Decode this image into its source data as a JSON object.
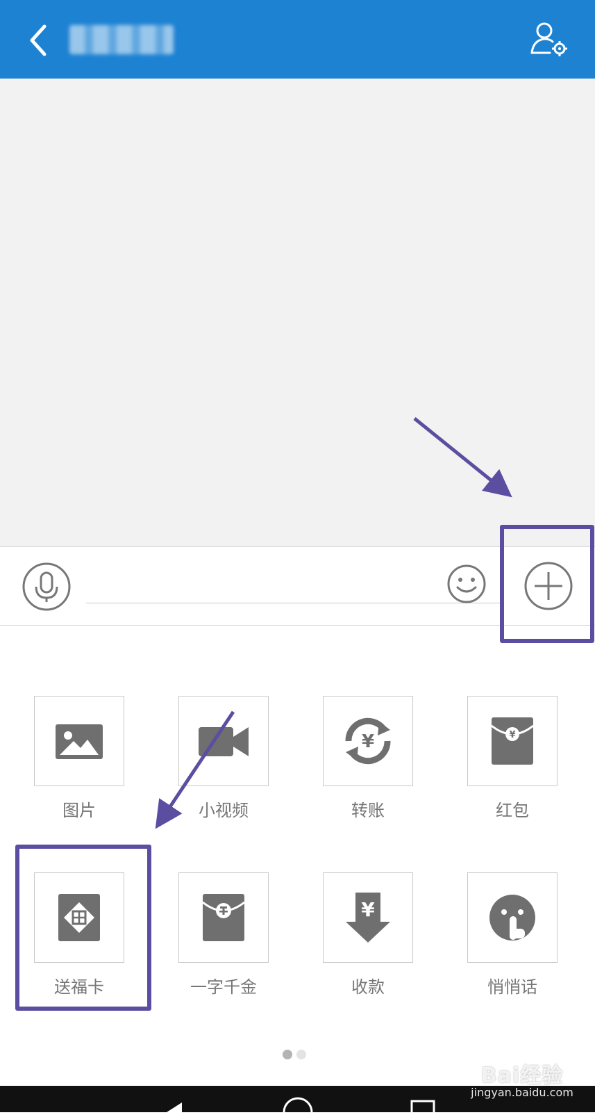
{
  "colors": {
    "header": "#1e82d2",
    "annotation": "#5b4ea0",
    "icon": "#6f6f6f",
    "chat_bg": "#f2f2f2"
  },
  "header": {
    "back_icon": "chevron-left-icon",
    "title": "",
    "profile_icon": "person-settings-icon"
  },
  "input_bar": {
    "voice_icon": "microphone-icon",
    "text_value": "",
    "emoji_icon": "smiley-icon",
    "more_icon": "plus-circle-icon"
  },
  "panel": {
    "items": [
      {
        "label": "图片",
        "icon": "image-icon"
      },
      {
        "label": "小视频",
        "icon": "video-camera-icon"
      },
      {
        "label": "转账",
        "icon": "transfer-icon"
      },
      {
        "label": "红包",
        "icon": "red-packet-icon"
      },
      {
        "label": "送福卡",
        "icon": "fu-card-icon"
      },
      {
        "label": "一字千金",
        "icon": "word-packet-icon"
      },
      {
        "label": "收款",
        "icon": "receive-money-icon"
      },
      {
        "label": "悄悄话",
        "icon": "whisper-icon"
      }
    ],
    "page_count": 2,
    "current_page": 1
  },
  "watermark": {
    "logo": "Bai经验",
    "url": "jingyan.baidu.com"
  }
}
